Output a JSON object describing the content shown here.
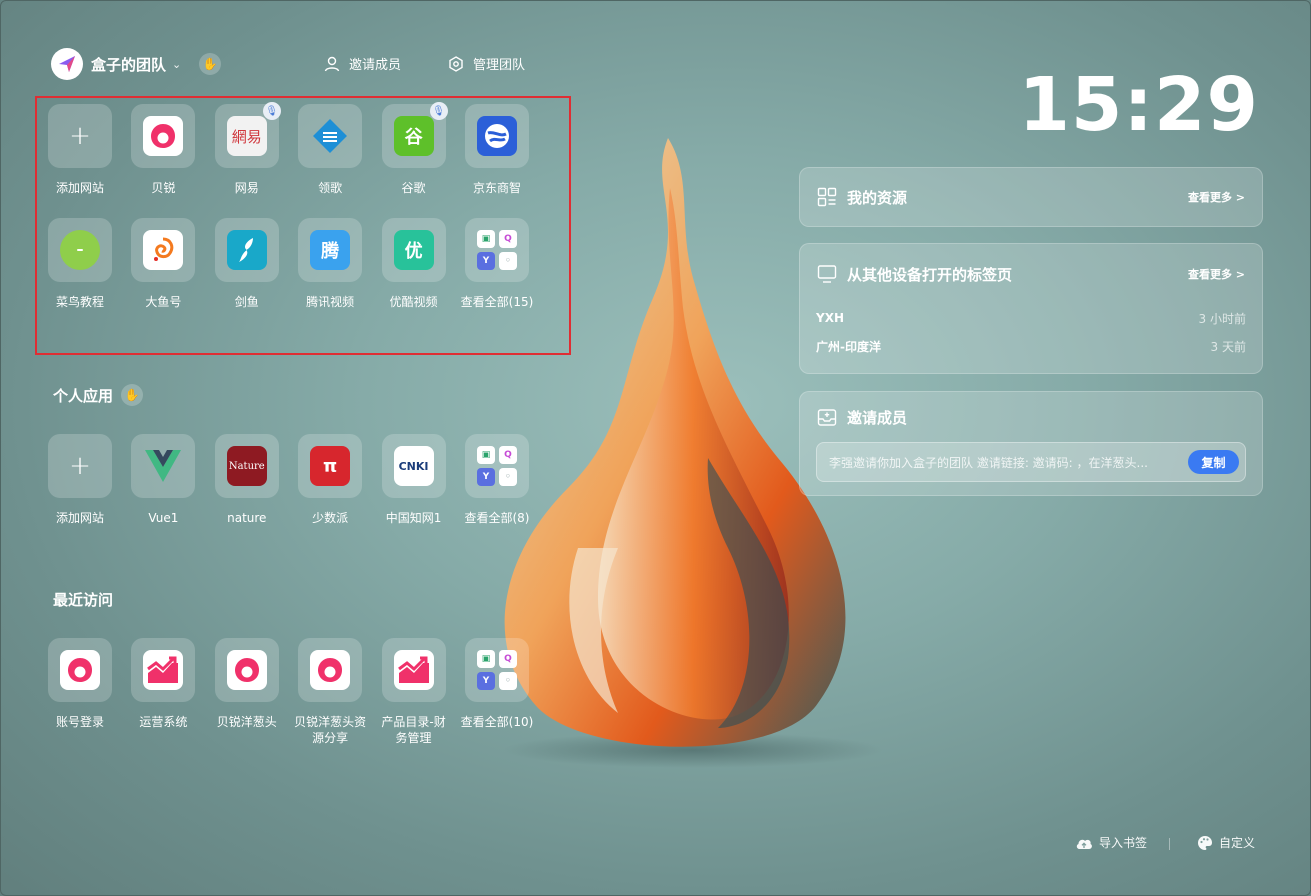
{
  "header": {
    "team_name": "盒子的团队",
    "invite_label": "邀请成员",
    "manage_label": "管理团队"
  },
  "clock": "15:29",
  "team_sites": [
    {
      "label": "添加网站",
      "icon": "plus-icon"
    },
    {
      "label": "贝锐",
      "icon": "beirui-icon",
      "color": "#f0316a"
    },
    {
      "label": "网易",
      "icon": "netease-icon",
      "text": "網易",
      "color": "#d0363c",
      "mic": true
    },
    {
      "label": "领歌",
      "icon": "lingge-icon",
      "color": "#1e8fd6"
    },
    {
      "label": "谷歌",
      "icon": "gu-icon",
      "text": "谷",
      "color": "#5ec02a",
      "mic": true
    },
    {
      "label": "京东商智",
      "icon": "jd-icon",
      "color": "#2b5fd8"
    },
    {
      "label": "菜鸟教程",
      "icon": "runoob-icon",
      "text": "</>",
      "color": "#8fce4b"
    },
    {
      "label": "大鱼号",
      "icon": "dayu-icon",
      "color": "#f47a1f"
    },
    {
      "label": "剑鱼",
      "icon": "jianyu-icon",
      "color": "#19a8c9"
    },
    {
      "label": "腾讯视频",
      "icon": "tencent-video-icon",
      "text": "腾",
      "color": "#3aa2ee"
    },
    {
      "label": "优酷视频",
      "icon": "youku-icon",
      "text": "优",
      "color": "#28c29a"
    },
    {
      "label": "查看全部(15)",
      "icon": "view-all-icon"
    }
  ],
  "personal": {
    "title": "个人应用",
    "apps": [
      {
        "label": "添加网站",
        "icon": "plus-icon"
      },
      {
        "label": "Vue1",
        "icon": "vue-icon"
      },
      {
        "label": "nature",
        "icon": "nature-icon",
        "text": "Nature",
        "color": "#8e1a22"
      },
      {
        "label": "少数派",
        "icon": "sspai-icon",
        "text": "π",
        "color": "#d7262d"
      },
      {
        "label": "中国知网1",
        "icon": "cnki-icon",
        "text": "CNKI",
        "color": "#ffffff"
      },
      {
        "label": "查看全部(8)",
        "icon": "view-all-icon"
      }
    ]
  },
  "recent": {
    "title": "最近访问",
    "items": [
      {
        "label": "账号登录",
        "icon": "beirui-icon"
      },
      {
        "label": "运营系统",
        "icon": "chart-up-icon"
      },
      {
        "label": "贝锐洋葱头",
        "icon": "beirui-icon"
      },
      {
        "label": "贝锐洋葱头资源分享",
        "icon": "beirui-icon"
      },
      {
        "label": "产品目录-财务管理",
        "icon": "chart-up-icon"
      },
      {
        "label": "查看全部(10)",
        "icon": "view-all-icon"
      }
    ]
  },
  "resources": {
    "title": "我的资源",
    "more": "查看更多 >"
  },
  "other_tabs": {
    "title": "从其他设备打开的标签页",
    "more": "查看更多 >",
    "rows": [
      {
        "name": "YXH",
        "time": "3 小时前"
      },
      {
        "name": "广州-印度洋",
        "time": "3 天前"
      }
    ]
  },
  "invite": {
    "title": "邀请成员",
    "text": "李强邀请你加入盒子的团队 邀请链接: 邀请码: ，在洋葱头...",
    "copy_label": "复制"
  },
  "footer": {
    "import_label": "导入书签",
    "custom_label": "自定义"
  },
  "colors": {
    "accent": "#3a7af2",
    "selection": "#e02d33"
  }
}
